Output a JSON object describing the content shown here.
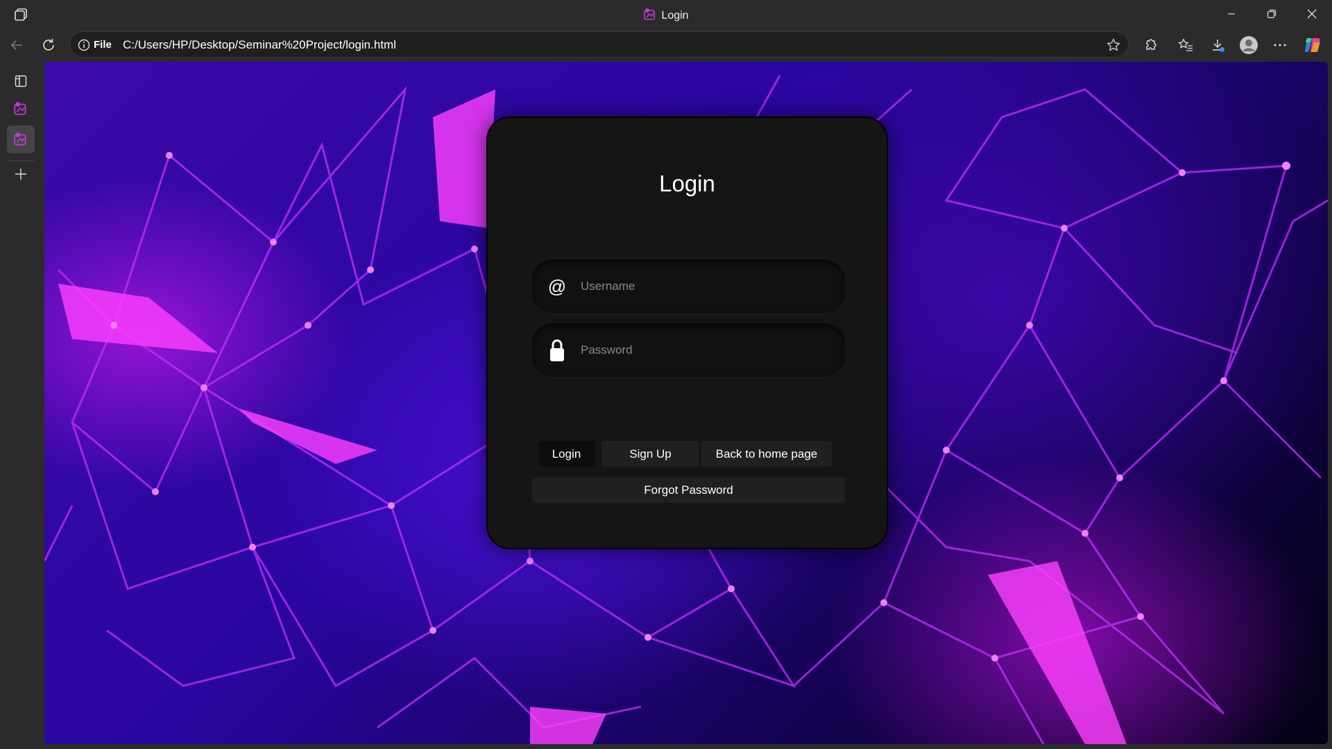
{
  "window": {
    "title": "Login"
  },
  "address_bar": {
    "scheme_label": "File",
    "url": "C:/Users/HP/Desktop/Seminar%20Project/login.html"
  },
  "login_card": {
    "title": "Login",
    "username_placeholder": "Username",
    "password_placeholder": "Password",
    "username_icon": "@",
    "login_button": "Login",
    "signup_button": "Sign Up",
    "home_button": "Back to home page",
    "forgot_button": "Forgot Password"
  },
  "colors": {
    "accent_magenta": "#e81eff",
    "background_purple": "#3a0aa8",
    "card_bg": "#151515"
  }
}
